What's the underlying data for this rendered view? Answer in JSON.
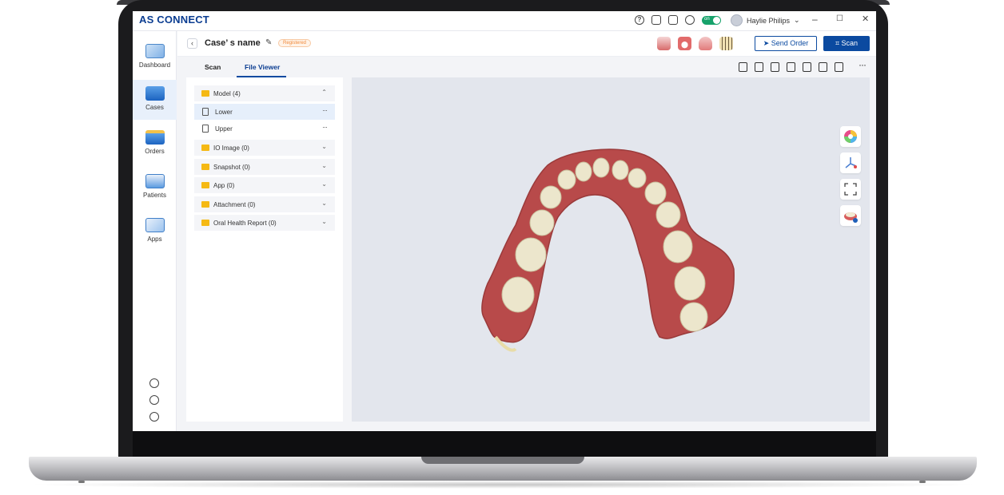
{
  "app": {
    "brand": "AS CONNECT",
    "theme_color": "#0b4aa0"
  },
  "titlebar": {
    "icons": [
      "help-icon",
      "screen-share-icon",
      "calendar-icon",
      "cloud-icon"
    ],
    "toggle_label": "on",
    "user_name": "Haylie Philips",
    "window_controls": [
      "–",
      "☐",
      "✕"
    ]
  },
  "sidebar": {
    "items": [
      {
        "label": "Dashboard",
        "icon": "dashboard-icon"
      },
      {
        "label": "Cases",
        "icon": "cases-icon"
      },
      {
        "label": "Orders",
        "icon": "orders-icon"
      },
      {
        "label": "Patients",
        "icon": "patients-icon"
      },
      {
        "label": "Apps",
        "icon": "apps-icon"
      }
    ],
    "utilities": [
      "settings-icon",
      "globe-icon",
      "info-icon"
    ]
  },
  "case": {
    "title": "Case’ s name",
    "status": "Registered",
    "send_order_label": "Send Order",
    "scan_label": "Scan"
  },
  "tabs": [
    {
      "label": "Scan"
    },
    {
      "label": "File Viewer"
    }
  ],
  "files": {
    "groups": [
      {
        "label": "Model (4)",
        "expanded": true
      },
      {
        "label": "IO Image (0)"
      },
      {
        "label": "Snapshot (0)"
      },
      {
        "label": "App (0)"
      },
      {
        "label": "Attachment (0)"
      },
      {
        "label": "Oral Health Report (0)"
      }
    ],
    "model_files": [
      {
        "label": "Lower",
        "selected": true
      },
      {
        "label": "Upper"
      }
    ]
  }
}
